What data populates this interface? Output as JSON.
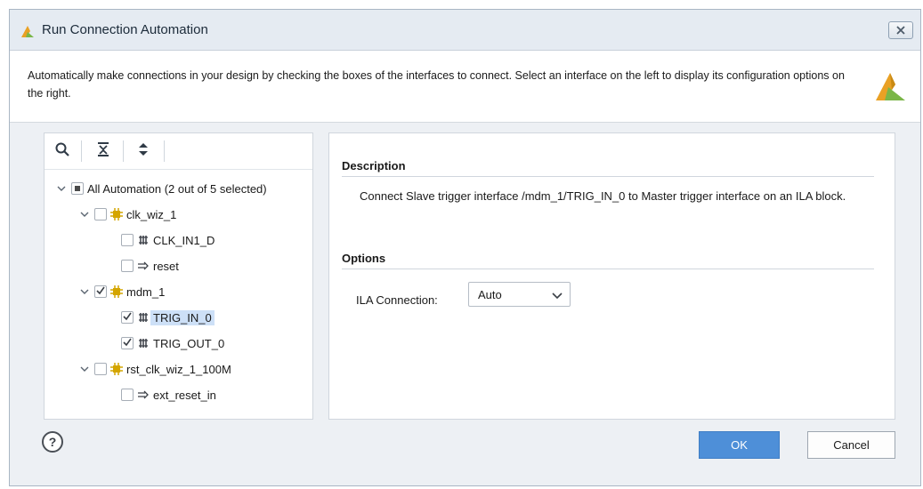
{
  "window": {
    "title": "Run Connection Automation"
  },
  "header": {
    "description": "Automatically make connections in your design by checking the boxes of the interfaces to connect. Select an interface on the left to display its configuration options on the right."
  },
  "toolbar": {
    "icons": [
      "search-icon",
      "collapse-all-icon",
      "expand-all-icon"
    ]
  },
  "tree": {
    "root": {
      "label": "All Automation (2 out of 5 selected)",
      "state": "partial"
    },
    "items": [
      {
        "label": "clk_wiz_1",
        "checked": false,
        "type": "block"
      },
      {
        "label": "CLK_IN1_D",
        "checked": false,
        "type": "interface"
      },
      {
        "label": "reset",
        "checked": false,
        "type": "port"
      },
      {
        "label": "mdm_1",
        "checked": true,
        "type": "block"
      },
      {
        "label": "TRIG_IN_0",
        "checked": true,
        "type": "interface",
        "selected": true
      },
      {
        "label": "TRIG_OUT_0",
        "checked": true,
        "type": "interface"
      },
      {
        "label": "rst_clk_wiz_1_100M",
        "checked": false,
        "type": "block"
      },
      {
        "label": "ext_reset_in",
        "checked": false,
        "type": "port"
      }
    ]
  },
  "details": {
    "description_title": "Description",
    "description_text": "Connect Slave trigger interface /mdm_1/TRIG_IN_0 to Master trigger interface on an ILA block.",
    "options_title": "Options",
    "ila_label": "ILA Connection:",
    "ila_value": "Auto"
  },
  "footer": {
    "help_label": "?",
    "ok_label": "OK",
    "cancel_label": "Cancel"
  },
  "colors": {
    "accent": "#4e8fd8",
    "selection": "#cde0f7",
    "title_bar": "#e5ebf2",
    "block_icon": "#d4a500"
  }
}
